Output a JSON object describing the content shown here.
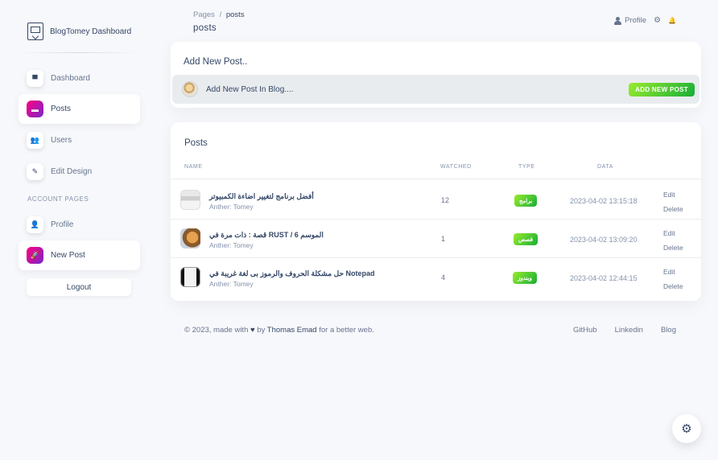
{
  "brand": {
    "name": "BlogTomey Dashboard",
    "logo_icon": "dashboard-logo-icon"
  },
  "sidebar": {
    "items": [
      {
        "label": "Dashboard",
        "icon": "shop-icon",
        "glyph": "▀"
      },
      {
        "label": "Posts",
        "icon": "card-icon",
        "glyph": "▬",
        "active": true
      },
      {
        "label": "Users",
        "icon": "users-icon",
        "glyph": "👥"
      },
      {
        "label": "Edit Design",
        "icon": "edit-icon",
        "glyph": "✎"
      }
    ],
    "section_label": "ACCOUNT PAGES",
    "account_items": [
      {
        "label": "Profile",
        "icon": "person-icon",
        "glyph": "👤"
      },
      {
        "label": "New Post",
        "icon": "rocket-icon",
        "glyph": "🚀",
        "active": true
      }
    ],
    "logout_label": "Logout"
  },
  "breadcrumb": {
    "parent": "Pages",
    "separator": "/",
    "current": "posts"
  },
  "page_title": "posts",
  "topbar": {
    "profile_label": "Profile",
    "settings_glyph": "⚙",
    "bell_glyph": "🔔"
  },
  "add_card": {
    "title": "Add New Post..",
    "row_text": "Add New Post In Blog....",
    "button_label": "ADD NEW POST"
  },
  "posts_card": {
    "title": "Posts",
    "columns": [
      "NAME",
      "WATCHED",
      "TYPE",
      "DATA"
    ],
    "rows": [
      {
        "title": "أفضل برنامج لتغيير اضاءة الكمبيوتر",
        "author": "Anther: Tomey",
        "watched": "12",
        "type": "برامج",
        "date": "2023-04-02 13:15:18",
        "edit": "Edit",
        "delete": "Delete"
      },
      {
        "title": "قصة : ذات مرة في RUST / الموسم 6",
        "author": "Anther: Tomey",
        "watched": "1",
        "type": "قصص",
        "date": "2023-04-02 13:09:20",
        "edit": "Edit",
        "delete": "Delete"
      },
      {
        "title": "حل مشكلة الحروف والرموز بى لغة غريبة في Notepad",
        "author": "Anther: Tomey",
        "watched": "4",
        "type": "ويندوز",
        "date": "2023-04-02 12:44:15",
        "edit": "Edit",
        "delete": "Delete"
      }
    ]
  },
  "footer": {
    "prefix": "© 2023, made with",
    "heart_glyph": "♥",
    "by": "by",
    "author": "Thomas Emad",
    "suffix": "for a better web.",
    "links": [
      "GitHub",
      "Linkedin",
      "Blog"
    ]
  },
  "fab_glyph": "⚙",
  "colors": {
    "accent_gradient_start": "#7928ca",
    "accent_gradient_end": "#ff0080",
    "success_start": "#17ad37",
    "success_end": "#98ec2d",
    "text": "#344767"
  }
}
